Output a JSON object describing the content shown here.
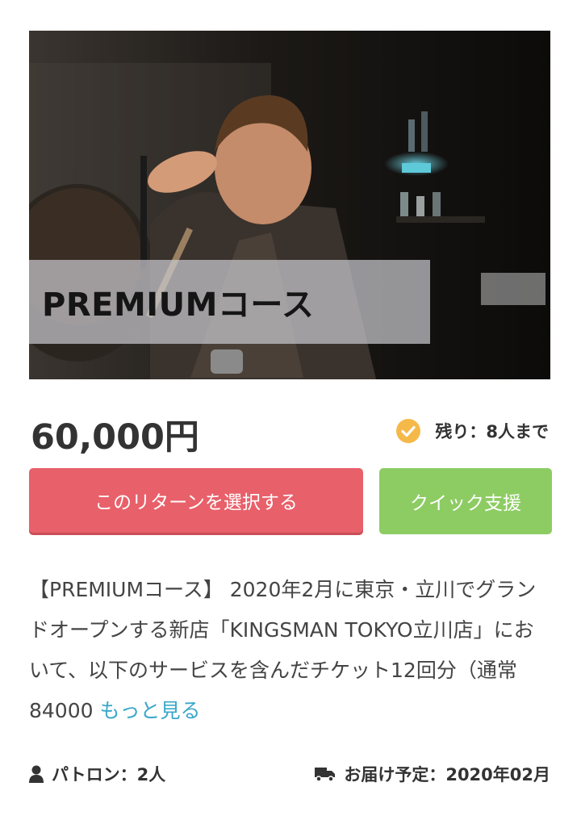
{
  "hero": {
    "caption": "PREMIUMコース",
    "image_desc": "barber-cutting-hair-photo"
  },
  "price": "60,000円",
  "remaining": {
    "label": "残り：8人まで",
    "icon": "check-circle-icon",
    "icon_color": "#f5b94a"
  },
  "buttons": {
    "select_label": "このリターンを選択する",
    "select_color": "#e8606a",
    "quick_label": "クイック支援",
    "quick_color": "#8dcc63"
  },
  "description": {
    "text": "【PREMIUMコース】 2020年2月に東京・立川でグランドオープンする新店「KINGSMAN TOKYO立川店」において、以下のサービスを含んだチケット12回分（通常84000 ",
    "more_label": "もっと見る",
    "link_color": "#3aa7c9"
  },
  "meta": {
    "patron_label": "パトロン：2人",
    "patron_icon": "user-icon",
    "delivery_label": "お届け予定：2020年02月",
    "delivery_icon": "truck-icon"
  }
}
